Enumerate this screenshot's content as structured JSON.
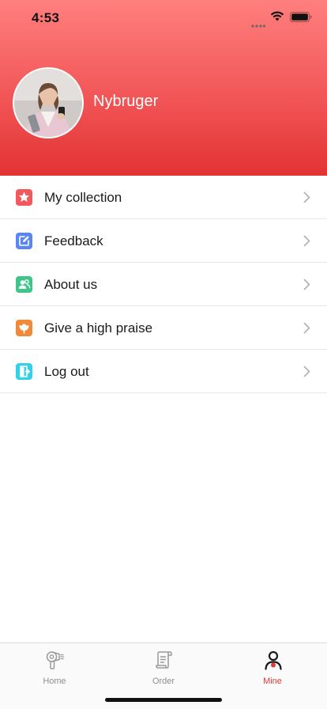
{
  "status_bar": {
    "time": "4:53"
  },
  "profile": {
    "username": "Nybruger"
  },
  "menu": {
    "items": [
      {
        "label": "My collection",
        "icon": "star-icon",
        "color": "#f2595c"
      },
      {
        "label": "Feedback",
        "icon": "edit-icon",
        "color": "#5b86f0"
      },
      {
        "label": "About us",
        "icon": "users-icon",
        "color": "#3fc58a"
      },
      {
        "label": "Give a high praise",
        "icon": "flower-icon",
        "color": "#f08a3a"
      },
      {
        "label": "Log out",
        "icon": "logout-icon",
        "color": "#33d1e8"
      }
    ]
  },
  "tabbar": {
    "tabs": [
      {
        "label": "Home",
        "icon": "hair-dryer-icon",
        "active": false
      },
      {
        "label": "Order",
        "icon": "receipt-icon",
        "active": false
      },
      {
        "label": "Mine",
        "icon": "person-icon",
        "active": true
      }
    ]
  },
  "colors": {
    "accent": "#e03a3a",
    "header_top": "#ff7f7e",
    "header_bottom": "#e23234"
  }
}
